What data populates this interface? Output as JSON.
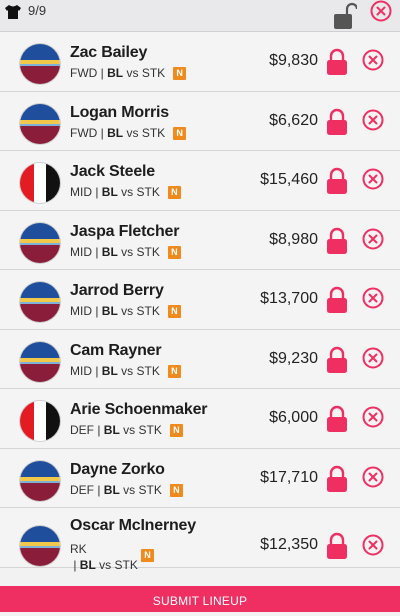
{
  "header": {
    "count": "9/9",
    "icons": {
      "jersey": "jersey-icon",
      "unlock": "unlock-icon",
      "close": "close-icon"
    }
  },
  "colors": {
    "accent": "#ef2f62",
    "badge": "#f08a1c",
    "brisbane": [
      "#1f4e9c",
      "#f2c84b",
      "#8a1d3a"
    ],
    "stkilda": [
      "#e31b23",
      "#ffffff",
      "#111111"
    ]
  },
  "players": [
    {
      "name": "Zac Bailey",
      "position": "FWD",
      "home": "BL",
      "vs": "vs",
      "away": "STK",
      "badge": "N",
      "price": "$9,830",
      "team": "brisbane"
    },
    {
      "name": "Logan Morris",
      "position": "FWD",
      "home": "BL",
      "vs": "vs",
      "away": "STK",
      "badge": "N",
      "price": "$6,620",
      "team": "brisbane"
    },
    {
      "name": "Jack Steele",
      "position": "MID",
      "home": "BL",
      "vs": "vs",
      "away": "STK",
      "badge": "N",
      "price": "$15,460",
      "team": "stkilda"
    },
    {
      "name": "Jaspa Fletcher",
      "position": "MID",
      "home": "BL",
      "vs": "vs",
      "away": "STK",
      "badge": "N",
      "price": "$8,980",
      "team": "brisbane"
    },
    {
      "name": "Jarrod Berry",
      "position": "MID",
      "home": "BL",
      "vs": "vs",
      "away": "STK",
      "badge": "N",
      "price": "$13,700",
      "team": "brisbane"
    },
    {
      "name": "Cam Rayner",
      "position": "MID",
      "home": "BL",
      "vs": "vs",
      "away": "STK",
      "badge": "N",
      "price": "$9,230",
      "team": "brisbane"
    },
    {
      "name": "Arie Schoenmaker",
      "position": "DEF",
      "home": "BL",
      "vs": "vs",
      "away": "STK",
      "badge": "N",
      "price": "$6,000",
      "team": "stkilda"
    },
    {
      "name": "Dayne Zorko",
      "position": "DEF",
      "home": "BL",
      "vs": "vs",
      "away": "STK",
      "badge": "N",
      "price": "$17,710",
      "team": "brisbane"
    },
    {
      "name": "Oscar McInerney",
      "position": "RK",
      "home": "BL",
      "vs": "vs",
      "away": "STK",
      "badge": "N",
      "price": "$12,350",
      "team": "brisbane"
    }
  ],
  "footer": {
    "submit_label": "SUBMIT LINEUP"
  }
}
